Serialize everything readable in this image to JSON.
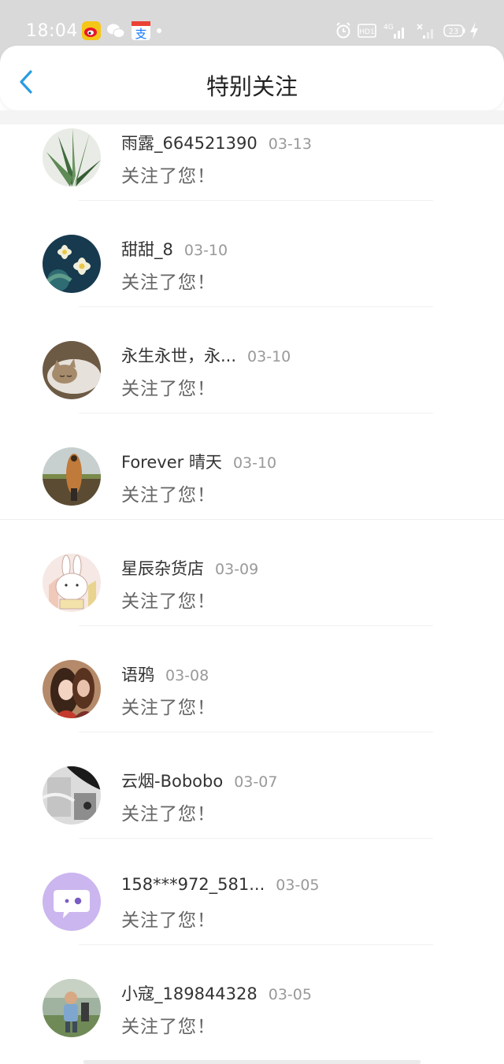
{
  "status_bar": {
    "time": "18:04",
    "icons": [
      "weibo-icon",
      "wechat-icon",
      "alipay-icon",
      "alarm-icon",
      "hd-icon",
      "4g-signal-icon",
      "signal-icon",
      "battery-icon",
      "charging-icon"
    ],
    "hd_label": "HD1",
    "network_label": "4G",
    "battery_level": "23"
  },
  "header": {
    "title": "特别关注",
    "back_icon": "chevron-left-icon",
    "accent_color": "#2a9be3"
  },
  "follows": [
    {
      "name": "雨露_664521390",
      "date": "03-13",
      "message": "关注了您！",
      "avatar": "aloe-plant"
    },
    {
      "name": "甜甜_8",
      "date": "03-10",
      "message": "关注了您！",
      "avatar": "white-flowers"
    },
    {
      "name": "永生永世，永...",
      "date": "03-10",
      "message": "关注了您！",
      "avatar": "sleeping-kitten"
    },
    {
      "name": "Forever 晴天",
      "date": "03-10",
      "message": "关注了您！",
      "avatar": "figure-outdoors"
    },
    {
      "name": "星辰杂货店",
      "date": "03-09",
      "message": "关注了您！",
      "avatar": "bunny-cartoon"
    },
    {
      "name": "语鸦",
      "date": "03-08",
      "message": "关注了您！",
      "avatar": "anime-couple"
    },
    {
      "name": "云烟-Bobobo",
      "date": "03-07",
      "message": "关注了您！",
      "avatar": "grayscale-photo"
    },
    {
      "name": "158***972_581...",
      "date": "03-05",
      "message": "关注了您！",
      "avatar": "default-chat-bubble"
    },
    {
      "name": "小寇_189844328",
      "date": "03-05",
      "message": "关注了您！",
      "avatar": "child-photo"
    }
  ]
}
